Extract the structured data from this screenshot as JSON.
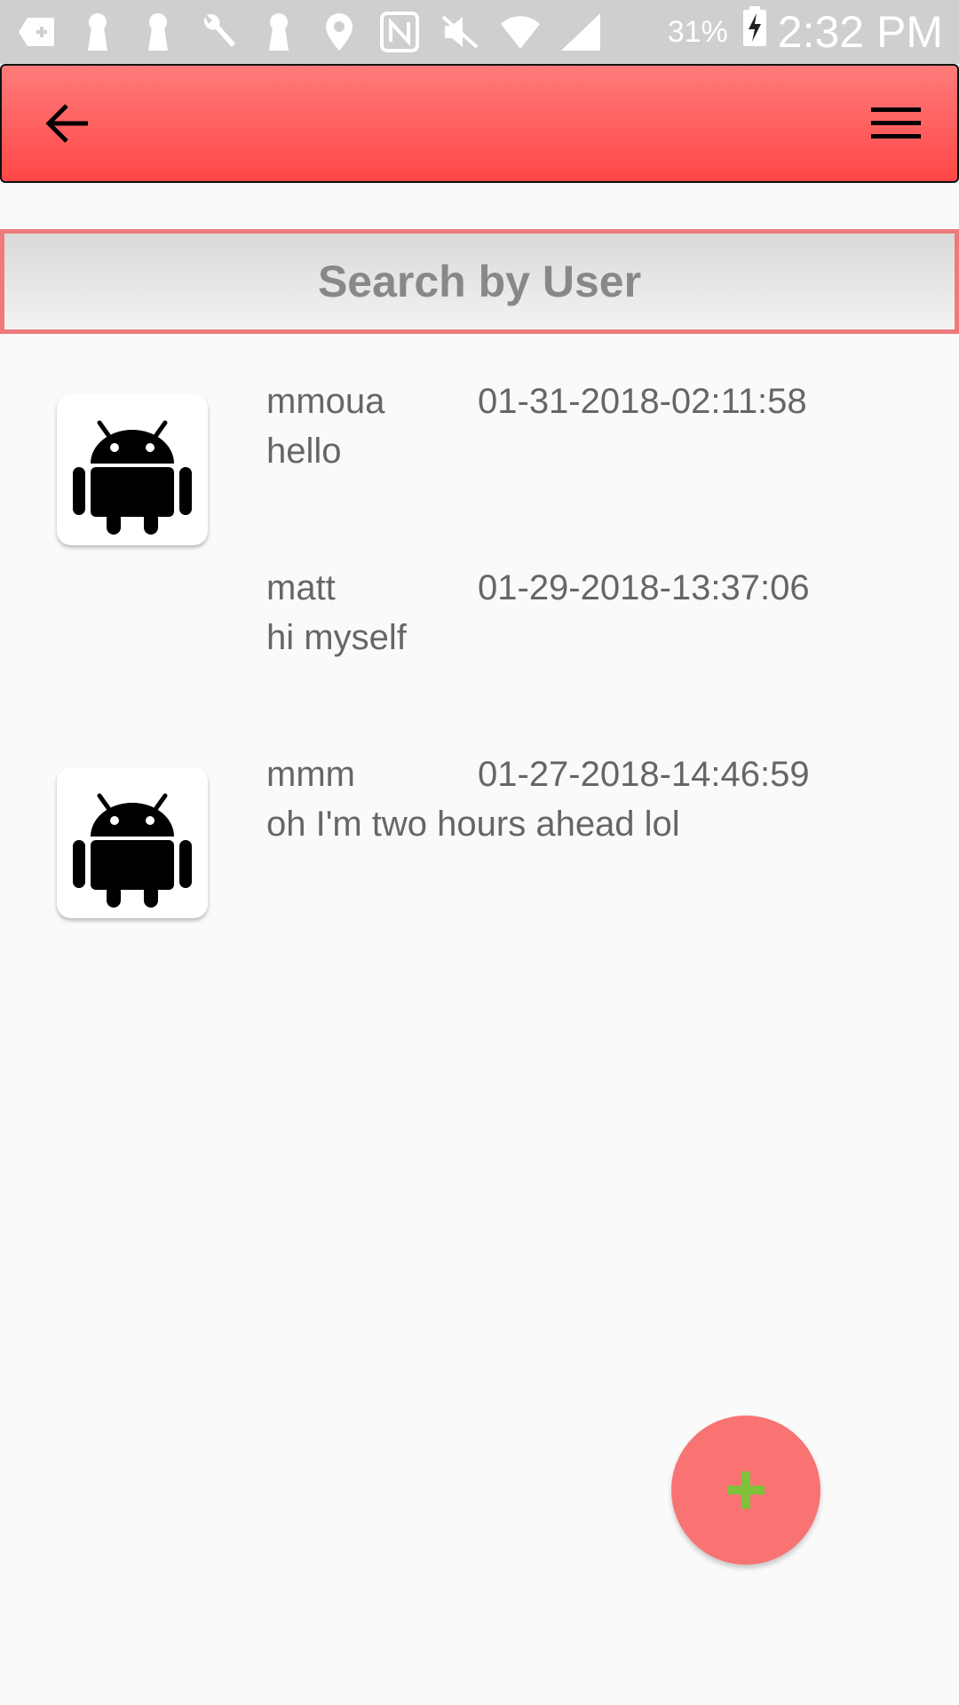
{
  "status_bar": {
    "battery": "31%",
    "time": "2:32 PM",
    "icons": [
      "add-notification-icon",
      "keyhole-icon",
      "keyhole-icon",
      "wrench-icon",
      "keyhole-icon",
      "location-pin-icon",
      "nfc-icon",
      "mute-icon",
      "wifi-icon",
      "signal-icon",
      "battery-charging-icon"
    ]
  },
  "app_bar": {
    "back_icon": "arrow-left-icon",
    "menu_icon": "hamburger-menu-icon",
    "color": "#ff4f4f"
  },
  "search": {
    "placeholder": "Search by User",
    "value": ""
  },
  "messages": [
    {
      "username": "mmoua",
      "timestamp": "01-31-2018-02:11:58",
      "text": "hello",
      "avatar": "android-robot-icon"
    },
    {
      "username": "matt",
      "timestamp": "01-29-2018-13:37:06",
      "text": "hi myself",
      "avatar": ""
    },
    {
      "username": "mmm",
      "timestamp": "01-27-2018-14:46:59",
      "text": "oh I'm two hours ahead lol",
      "avatar": "android-robot-icon"
    }
  ],
  "fab": {
    "icon": "plus-icon",
    "background": "#f97373",
    "icon_color": "#7fc23a"
  }
}
